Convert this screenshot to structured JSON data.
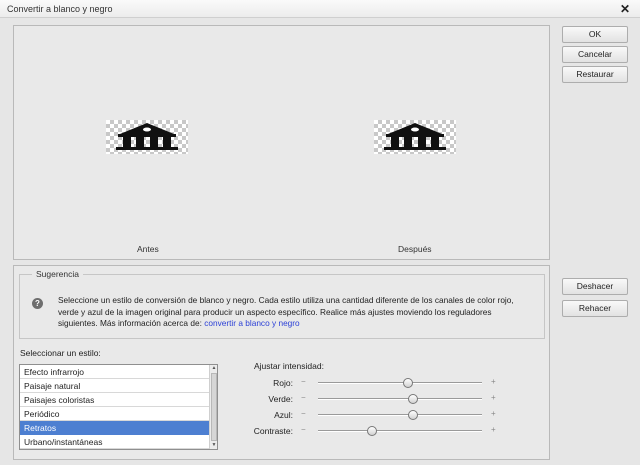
{
  "window": {
    "title": "Convertir a blanco y negro",
    "close_glyph": "✕"
  },
  "preview": {
    "before_label": "Antes",
    "after_label": "Después"
  },
  "buttons": {
    "ok": "OK",
    "cancel": "Cancelar",
    "restore": "Restaurar",
    "undo": "Deshacer",
    "redo": "Rehacer"
  },
  "hint": {
    "title": "Sugerencia",
    "icon": "?",
    "text_line1": "Seleccione un estilo de conversión de blanco y negro. Cada estilo utiliza una cantidad diferente de los canales de color rojo,",
    "text_line2": "verde y azul de la imagen original para producir un aspecto específico. Realice más ajustes moviendo los reguladores",
    "text_line3": "siguientes. Más información acerca de: ",
    "link": "convertir a blanco y negro"
  },
  "styles": {
    "label": "Seleccionar un estilo:",
    "items": [
      {
        "label": "Efecto infrarrojo",
        "selected": false
      },
      {
        "label": "Paisaje natural",
        "selected": false
      },
      {
        "label": "Paisajes coloristas",
        "selected": false
      },
      {
        "label": "Periódico",
        "selected": false
      },
      {
        "label": "Retratos",
        "selected": true
      },
      {
        "label": "Urbano/instantáneas",
        "selected": false
      }
    ]
  },
  "adjust": {
    "label": "Ajustar intensidad:",
    "minus": "−",
    "plus": "+",
    "sliders": [
      {
        "name": "Rojo:",
        "value": 0.55
      },
      {
        "name": "Verde:",
        "value": 0.58
      },
      {
        "name": "Azul:",
        "value": 0.58
      },
      {
        "name": "Contraste:",
        "value": 0.33
      }
    ]
  },
  "colors": {
    "selection": "#4d7fd1",
    "link": "#2a3fd6"
  }
}
